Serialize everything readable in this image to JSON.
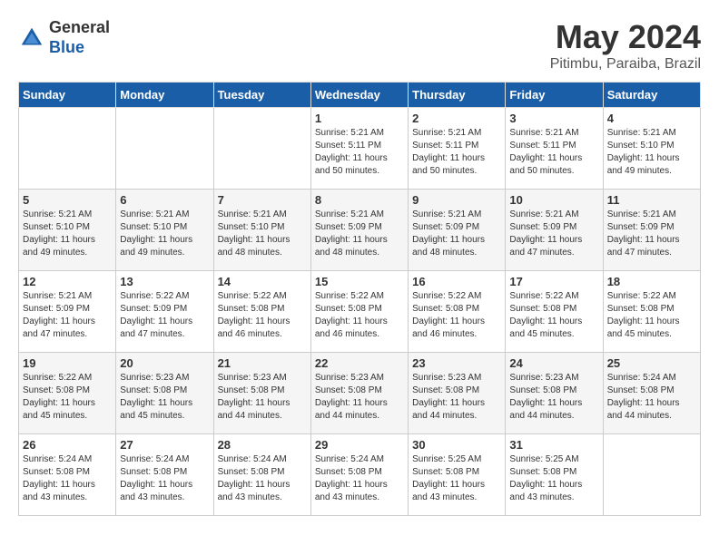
{
  "logo": {
    "general": "General",
    "blue": "Blue"
  },
  "title": "May 2024",
  "location": "Pitimbu, Paraiba, Brazil",
  "days_of_week": [
    "Sunday",
    "Monday",
    "Tuesday",
    "Wednesday",
    "Thursday",
    "Friday",
    "Saturday"
  ],
  "weeks": [
    [
      {
        "day": "",
        "sunrise": "",
        "sunset": "",
        "daylight": ""
      },
      {
        "day": "",
        "sunrise": "",
        "sunset": "",
        "daylight": ""
      },
      {
        "day": "",
        "sunrise": "",
        "sunset": "",
        "daylight": ""
      },
      {
        "day": "1",
        "sunrise": "Sunrise: 5:21 AM",
        "sunset": "Sunset: 5:11 PM",
        "daylight": "Daylight: 11 hours and 50 minutes."
      },
      {
        "day": "2",
        "sunrise": "Sunrise: 5:21 AM",
        "sunset": "Sunset: 5:11 PM",
        "daylight": "Daylight: 11 hours and 50 minutes."
      },
      {
        "day": "3",
        "sunrise": "Sunrise: 5:21 AM",
        "sunset": "Sunset: 5:11 PM",
        "daylight": "Daylight: 11 hours and 50 minutes."
      },
      {
        "day": "4",
        "sunrise": "Sunrise: 5:21 AM",
        "sunset": "Sunset: 5:10 PM",
        "daylight": "Daylight: 11 hours and 49 minutes."
      }
    ],
    [
      {
        "day": "5",
        "sunrise": "Sunrise: 5:21 AM",
        "sunset": "Sunset: 5:10 PM",
        "daylight": "Daylight: 11 hours and 49 minutes."
      },
      {
        "day": "6",
        "sunrise": "Sunrise: 5:21 AM",
        "sunset": "Sunset: 5:10 PM",
        "daylight": "Daylight: 11 hours and 49 minutes."
      },
      {
        "day": "7",
        "sunrise": "Sunrise: 5:21 AM",
        "sunset": "Sunset: 5:10 PM",
        "daylight": "Daylight: 11 hours and 48 minutes."
      },
      {
        "day": "8",
        "sunrise": "Sunrise: 5:21 AM",
        "sunset": "Sunset: 5:09 PM",
        "daylight": "Daylight: 11 hours and 48 minutes."
      },
      {
        "day": "9",
        "sunrise": "Sunrise: 5:21 AM",
        "sunset": "Sunset: 5:09 PM",
        "daylight": "Daylight: 11 hours and 48 minutes."
      },
      {
        "day": "10",
        "sunrise": "Sunrise: 5:21 AM",
        "sunset": "Sunset: 5:09 PM",
        "daylight": "Daylight: 11 hours and 47 minutes."
      },
      {
        "day": "11",
        "sunrise": "Sunrise: 5:21 AM",
        "sunset": "Sunset: 5:09 PM",
        "daylight": "Daylight: 11 hours and 47 minutes."
      }
    ],
    [
      {
        "day": "12",
        "sunrise": "Sunrise: 5:21 AM",
        "sunset": "Sunset: 5:09 PM",
        "daylight": "Daylight: 11 hours and 47 minutes."
      },
      {
        "day": "13",
        "sunrise": "Sunrise: 5:22 AM",
        "sunset": "Sunset: 5:09 PM",
        "daylight": "Daylight: 11 hours and 47 minutes."
      },
      {
        "day": "14",
        "sunrise": "Sunrise: 5:22 AM",
        "sunset": "Sunset: 5:08 PM",
        "daylight": "Daylight: 11 hours and 46 minutes."
      },
      {
        "day": "15",
        "sunrise": "Sunrise: 5:22 AM",
        "sunset": "Sunset: 5:08 PM",
        "daylight": "Daylight: 11 hours and 46 minutes."
      },
      {
        "day": "16",
        "sunrise": "Sunrise: 5:22 AM",
        "sunset": "Sunset: 5:08 PM",
        "daylight": "Daylight: 11 hours and 46 minutes."
      },
      {
        "day": "17",
        "sunrise": "Sunrise: 5:22 AM",
        "sunset": "Sunset: 5:08 PM",
        "daylight": "Daylight: 11 hours and 45 minutes."
      },
      {
        "day": "18",
        "sunrise": "Sunrise: 5:22 AM",
        "sunset": "Sunset: 5:08 PM",
        "daylight": "Daylight: 11 hours and 45 minutes."
      }
    ],
    [
      {
        "day": "19",
        "sunrise": "Sunrise: 5:22 AM",
        "sunset": "Sunset: 5:08 PM",
        "daylight": "Daylight: 11 hours and 45 minutes."
      },
      {
        "day": "20",
        "sunrise": "Sunrise: 5:23 AM",
        "sunset": "Sunset: 5:08 PM",
        "daylight": "Daylight: 11 hours and 45 minutes."
      },
      {
        "day": "21",
        "sunrise": "Sunrise: 5:23 AM",
        "sunset": "Sunset: 5:08 PM",
        "daylight": "Daylight: 11 hours and 44 minutes."
      },
      {
        "day": "22",
        "sunrise": "Sunrise: 5:23 AM",
        "sunset": "Sunset: 5:08 PM",
        "daylight": "Daylight: 11 hours and 44 minutes."
      },
      {
        "day": "23",
        "sunrise": "Sunrise: 5:23 AM",
        "sunset": "Sunset: 5:08 PM",
        "daylight": "Daylight: 11 hours and 44 minutes."
      },
      {
        "day": "24",
        "sunrise": "Sunrise: 5:23 AM",
        "sunset": "Sunset: 5:08 PM",
        "daylight": "Daylight: 11 hours and 44 minutes."
      },
      {
        "day": "25",
        "sunrise": "Sunrise: 5:24 AM",
        "sunset": "Sunset: 5:08 PM",
        "daylight": "Daylight: 11 hours and 44 minutes."
      }
    ],
    [
      {
        "day": "26",
        "sunrise": "Sunrise: 5:24 AM",
        "sunset": "Sunset: 5:08 PM",
        "daylight": "Daylight: 11 hours and 43 minutes."
      },
      {
        "day": "27",
        "sunrise": "Sunrise: 5:24 AM",
        "sunset": "Sunset: 5:08 PM",
        "daylight": "Daylight: 11 hours and 43 minutes."
      },
      {
        "day": "28",
        "sunrise": "Sunrise: 5:24 AM",
        "sunset": "Sunset: 5:08 PM",
        "daylight": "Daylight: 11 hours and 43 minutes."
      },
      {
        "day": "29",
        "sunrise": "Sunrise: 5:24 AM",
        "sunset": "Sunset: 5:08 PM",
        "daylight": "Daylight: 11 hours and 43 minutes."
      },
      {
        "day": "30",
        "sunrise": "Sunrise: 5:25 AM",
        "sunset": "Sunset: 5:08 PM",
        "daylight": "Daylight: 11 hours and 43 minutes."
      },
      {
        "day": "31",
        "sunrise": "Sunrise: 5:25 AM",
        "sunset": "Sunset: 5:08 PM",
        "daylight": "Daylight: 11 hours and 43 minutes."
      },
      {
        "day": "",
        "sunrise": "",
        "sunset": "",
        "daylight": ""
      }
    ]
  ]
}
